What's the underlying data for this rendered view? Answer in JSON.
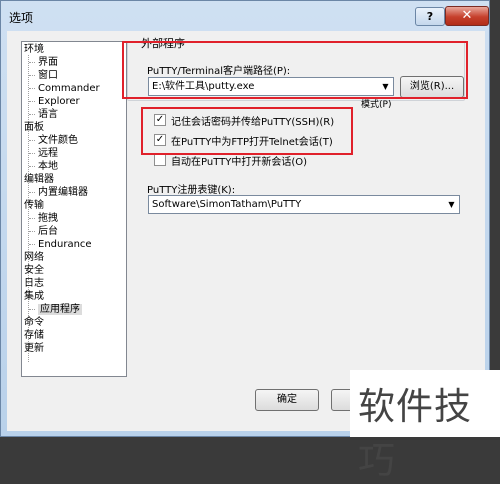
{
  "window": {
    "title": "选项",
    "help_label": "?",
    "close_label": "✕"
  },
  "tree": {
    "items": [
      {
        "label": "环境",
        "level": 0
      },
      {
        "label": "界面",
        "level": 1
      },
      {
        "label": "窗口",
        "level": 1
      },
      {
        "label": "Commander",
        "level": 1
      },
      {
        "label": "Explorer",
        "level": 1
      },
      {
        "label": "语言",
        "level": 1
      },
      {
        "label": "面板",
        "level": 0
      },
      {
        "label": "文件颜色",
        "level": 1
      },
      {
        "label": "远程",
        "level": 1
      },
      {
        "label": "本地",
        "level": 1
      },
      {
        "label": "编辑器",
        "level": 0
      },
      {
        "label": "内置编辑器",
        "level": 1
      },
      {
        "label": "传输",
        "level": 0
      },
      {
        "label": "拖拽",
        "level": 1
      },
      {
        "label": "后台",
        "level": 1
      },
      {
        "label": "Endurance",
        "level": 1
      },
      {
        "label": "网络",
        "level": 0
      },
      {
        "label": "安全",
        "level": 0
      },
      {
        "label": "日志",
        "level": 0
      },
      {
        "label": "集成",
        "level": 0
      },
      {
        "label": "应用程序",
        "level": 1,
        "selected": true
      },
      {
        "label": "命令",
        "level": 0
      },
      {
        "label": "存储",
        "level": 0
      },
      {
        "label": "更新",
        "level": 0
      }
    ]
  },
  "external_programs": {
    "group_title": "外部程序",
    "path_label": "PuTTY/Terminal客户端路径(P):",
    "path_value": "E:\\软件工具\\putty.exe",
    "browse_label": "浏览(R)...",
    "pattern_label": "模式(P)"
  },
  "options": [
    {
      "label": "记住会话密码并传给PuTTY(SSH)(R)",
      "checked": true
    },
    {
      "label": "在PuTTY中为FTP打开Telnet会话(T)",
      "checked": true
    },
    {
      "label": "自动在PuTTY中打开新会话(O)",
      "checked": false
    }
  ],
  "registry": {
    "label": "PuTTY注册表键(K):",
    "value": "Software\\SimonTatham\\PuTTY"
  },
  "footer": {
    "ok_label": "确定"
  },
  "checkmark_glyph": "✓",
  "watermark": "软件技巧",
  "colors": {
    "highlight_border": "#e0212b"
  }
}
